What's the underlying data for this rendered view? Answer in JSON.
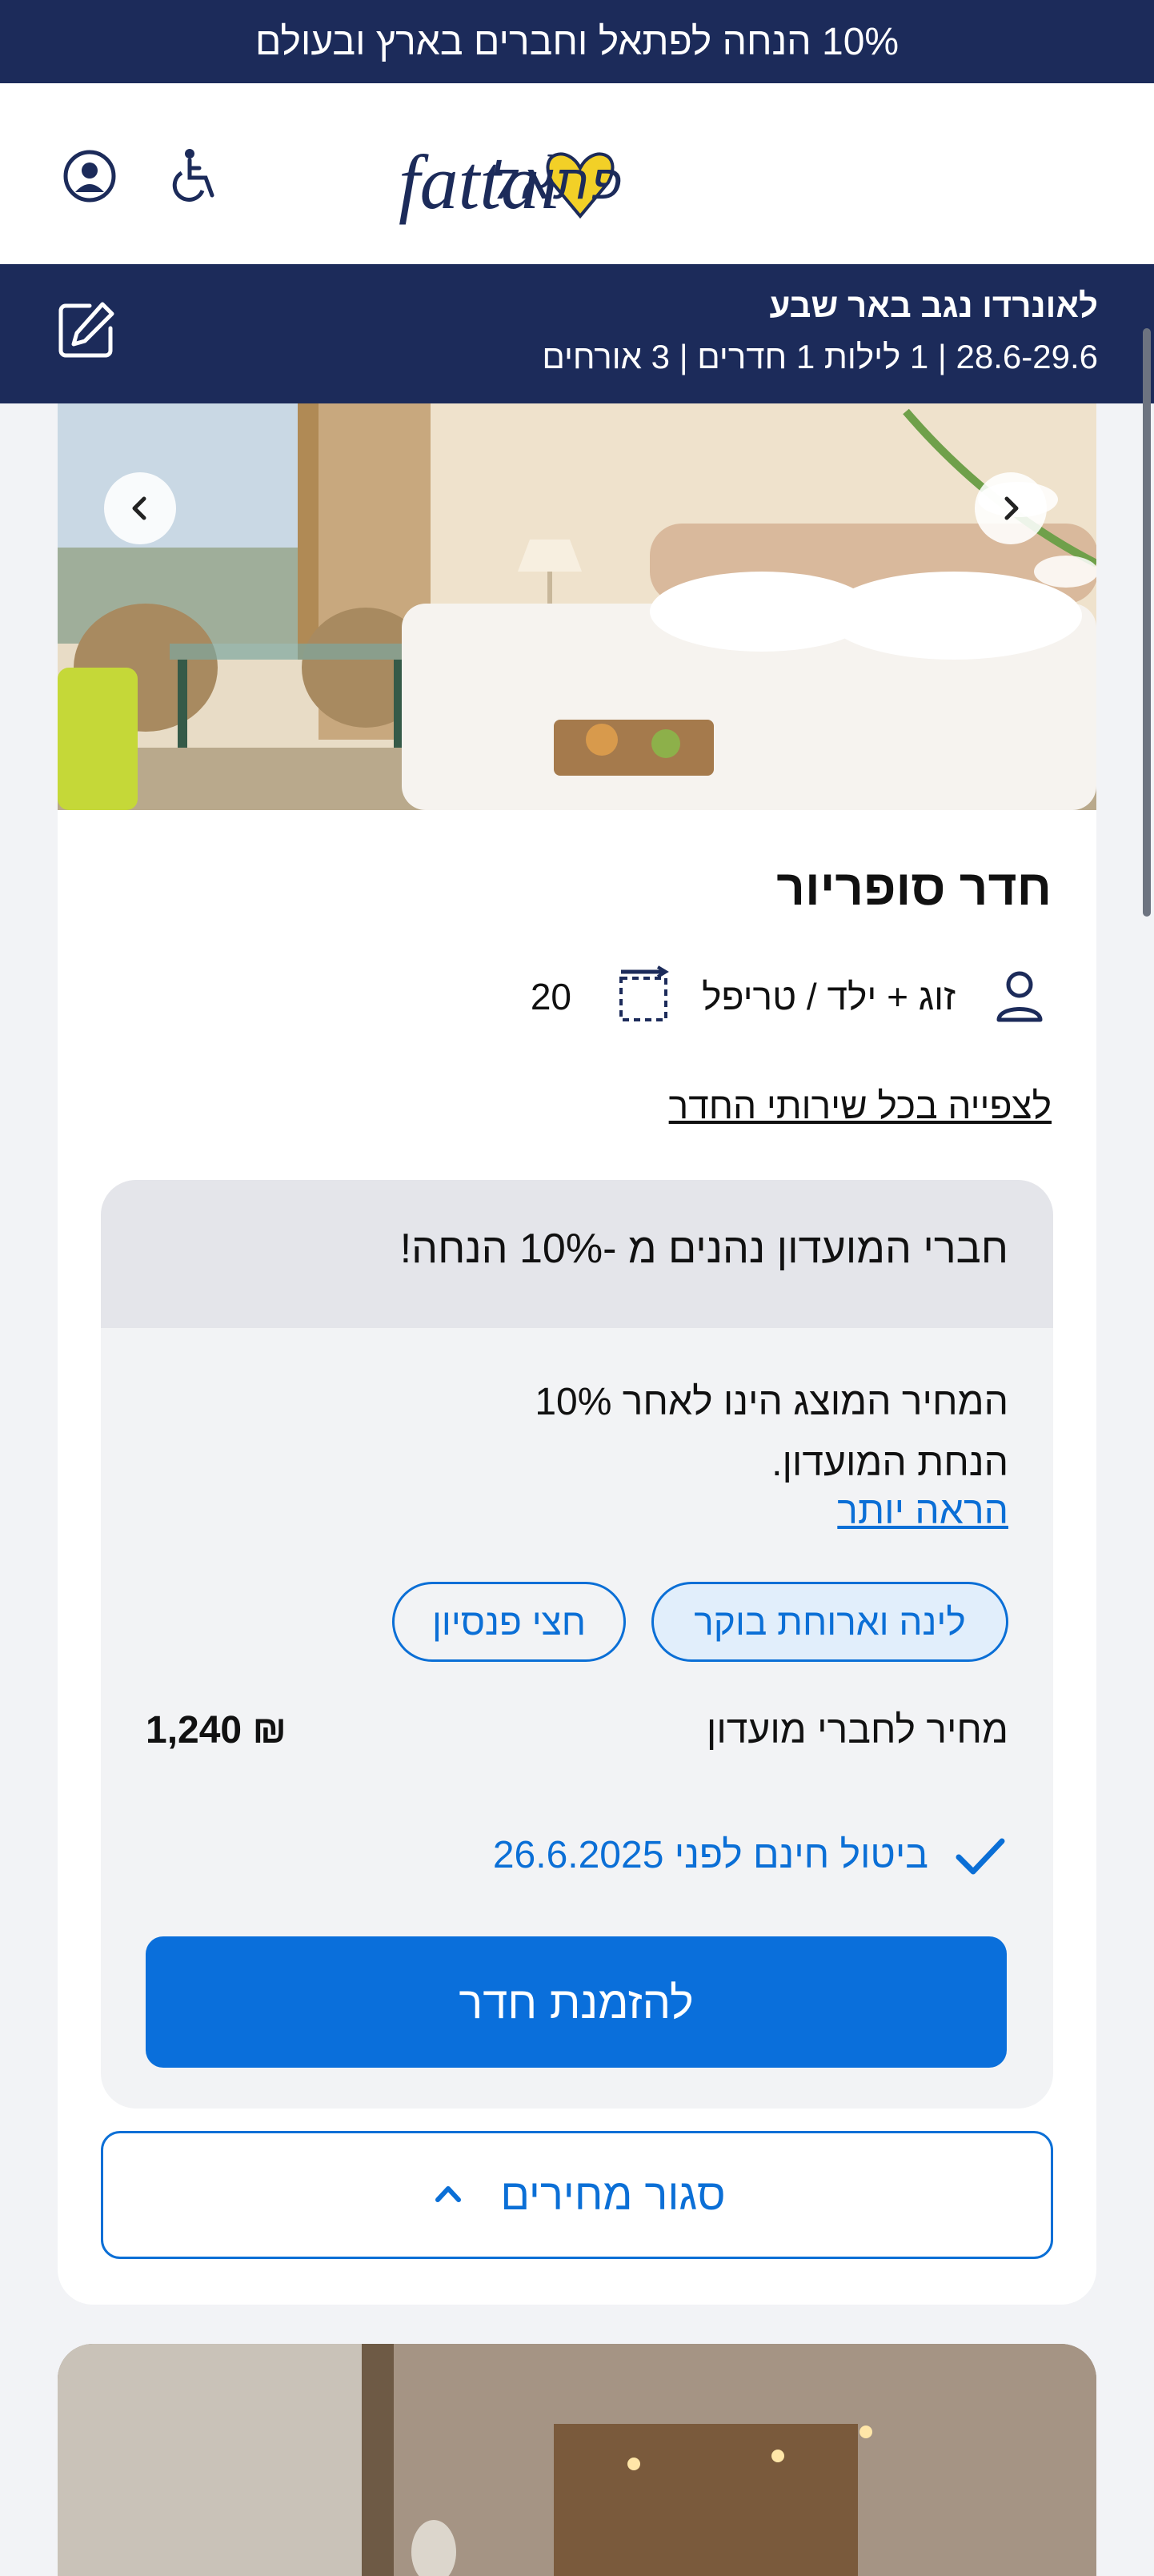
{
  "promo_banner": {
    "text": "10% הנחה לפתאל וחברים בארץ ובעולם"
  },
  "header": {
    "logo_alt": "fattal פתאל",
    "icons": [
      "account-icon",
      "accessibility-icon"
    ]
  },
  "search_summary": {
    "hotel": "לאונרדו נגב באר שבע",
    "details": "28.6-29.6 | 1 לילות    1 חדרים | 3 אורחים",
    "edit_icon": "edit-icon"
  },
  "room": {
    "title": "חדר סופריור",
    "occupancy": "זוג + ילד / טריפל",
    "size": "20",
    "services_link": "לצפייה בכל שירותי החדר"
  },
  "rate": {
    "club_header": "חברי המועדון נהנים מ -10% הנחה!",
    "discount_note": "המחיר המוצג הינו לאחר 10% הנחת המועדון.",
    "read_more": "הראה יותר",
    "board_options": [
      "לינה וארוחת בוקר",
      "חצי פנסיון"
    ],
    "selected_board": "לינה וארוחת בוקר",
    "price_label": "מחיר לחברי מועדון",
    "price": "₪ 1,240",
    "cancellation": "ביטול חינם לפני 26.6.2025",
    "book_button": "להזמנת חדר"
  },
  "close_prices_button": "סגור מחירים",
  "colors": {
    "navy": "#1c2b5a",
    "primary_blue": "#0a6fdb",
    "logo_yellow": "#f2d027"
  }
}
